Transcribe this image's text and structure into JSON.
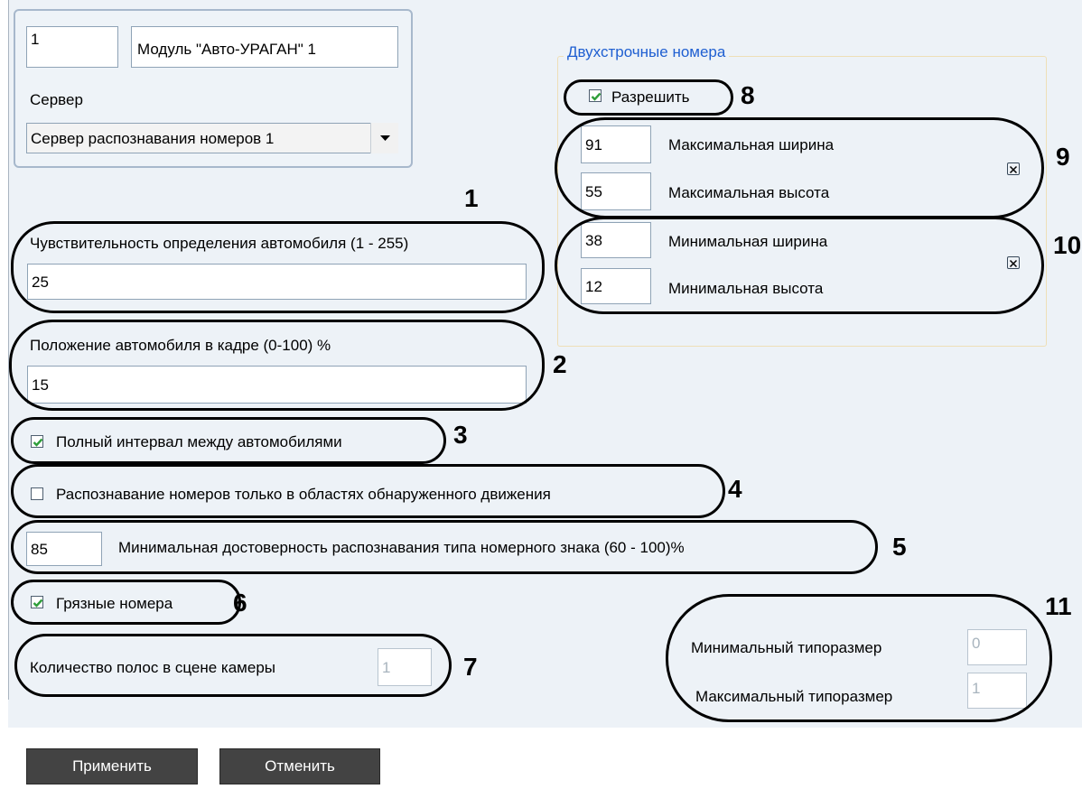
{
  "module": {
    "id_value": "1",
    "name_value": "Модуль \"Авто-УРАГАН\" 1",
    "server_label": "Сервер",
    "server_select": "Сервер распознавания номеров 1"
  },
  "sensitivity": {
    "label": "Чувствительность определения автомобиля (1 - 255)",
    "value": "25"
  },
  "position": {
    "label": "Положение автомобиля в кадре (0-100) %",
    "value": "15"
  },
  "full_interval": {
    "label": "Полный интервал между автомобилями",
    "checked": true
  },
  "motion_only": {
    "label": "Распознавание номеров только в областях обнаруженного движения",
    "checked": false
  },
  "min_confidence": {
    "value": "85",
    "label": "Минимальная достоверность распознавания типа номерного знака (60 - 100)%"
  },
  "dirty_plates": {
    "label": "Грязные номера",
    "checked": true
  },
  "lanes": {
    "label": "Количество полос в сцене камеры",
    "value": "1"
  },
  "two_line": {
    "title": "Двухстрочные номера",
    "allow_label": "Разрешить",
    "allow_checked": true,
    "max_width": {
      "value": "91",
      "label": "Максимальная ширина"
    },
    "max_height": {
      "value": "55",
      "label": "Максимальная высота"
    },
    "min_width": {
      "value": "38",
      "label": "Минимальная ширина"
    },
    "min_height": {
      "value": "12",
      "label": "Минимальная высота"
    }
  },
  "size_class": {
    "min": {
      "label": "Минимальный типоразмер",
      "value": "0"
    },
    "max": {
      "label": "Максимальный типоразмер",
      "value": "1"
    }
  },
  "callouts": [
    "1",
    "2",
    "3",
    "4",
    "5",
    "6",
    "7",
    "8",
    "9",
    "10",
    "11"
  ],
  "buttons": {
    "apply": "Применить",
    "cancel": "Отменить"
  },
  "colors": {
    "panel_bg": "#edf2f7",
    "group_title": "#1f5fd1",
    "check_mark": "#2f9e3a",
    "button_bg": "#434343"
  }
}
